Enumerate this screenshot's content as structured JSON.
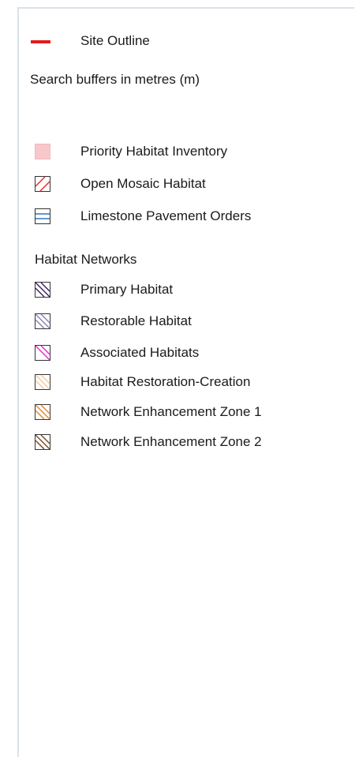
{
  "legend": {
    "site_outline": {
      "label": "Site Outline",
      "color": "#e41a1c",
      "icon": "red-line-icon"
    },
    "buffers_note": "Search buffers in metres (m)",
    "items": [
      {
        "label": "Priority Habitat Inventory",
        "icon": "solid-pink-swatch-icon",
        "color": "#f6c8cc"
      },
      {
        "label": "Open Mosaic Habitat",
        "icon": "red-diagonal-hatch-icon",
        "color": "#e4232b"
      },
      {
        "label": "Limestone Pavement Orders",
        "icon": "blue-horizontal-hatch-icon",
        "color": "#2f77c2"
      }
    ],
    "networks_title": "Habitat Networks",
    "networks": [
      {
        "label": "Primary Habitat",
        "icon": "purple-diagonal-hatch-icon",
        "color": "#3a1f5c"
      },
      {
        "label": "Restorable Habitat",
        "icon": "lavender-diagonal-hatch-icon",
        "color": "#8a7fb0"
      },
      {
        "label": "Associated Habitats",
        "icon": "magenta-diagonal-hatch-icon",
        "color": "#e02ad0"
      },
      {
        "label": "Habitat Restoration-Creation",
        "icon": "peach-diagonal-hatch-icon",
        "color": "#f6c79c"
      },
      {
        "label": "Network Enhancement Zone 1",
        "icon": "orange-diagonal-hatch-icon",
        "color": "#e0862a"
      },
      {
        "label": "Network Enhancement Zone 2",
        "icon": "brown-diagonal-hatch-icon",
        "color": "#7a4a1e"
      }
    ]
  }
}
